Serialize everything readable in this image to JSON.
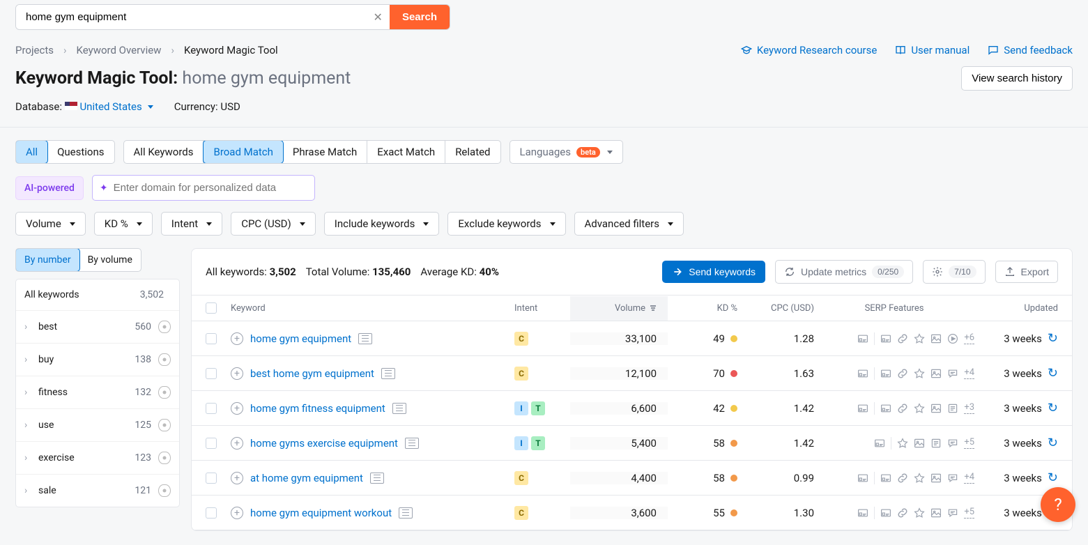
{
  "search": {
    "value": "home gym equipment",
    "button": "Search"
  },
  "breadcrumb": {
    "projects": "Projects",
    "overview": "Keyword Overview",
    "current": "Keyword Magic Tool"
  },
  "rlinks": {
    "course": "Keyword Research course",
    "manual": "User manual",
    "feedback": "Send feedback"
  },
  "title": {
    "main": "Keyword Magic Tool:",
    "sub": "home gym equipment"
  },
  "history_btn": "View search history",
  "meta": {
    "db_label": "Database:",
    "country": "United States",
    "cur_label": "Currency:",
    "cur": "USD"
  },
  "tabs1": {
    "all": "All",
    "questions": "Questions"
  },
  "tabs2": {
    "all_kw": "All Keywords",
    "broad": "Broad Match",
    "phrase": "Phrase Match",
    "exact": "Exact Match",
    "related": "Related"
  },
  "lang": {
    "label": "Languages",
    "badge": "beta"
  },
  "ai": {
    "tag": "AI-powered",
    "placeholder": "Enter domain for personalized data"
  },
  "filters": {
    "volume": "Volume",
    "kd": "KD %",
    "intent": "Intent",
    "cpc": "CPC (USD)",
    "include": "Include keywords",
    "exclude": "Exclude keywords",
    "advanced": "Advanced filters"
  },
  "side_tabs": {
    "number": "By number",
    "volume": "By volume"
  },
  "side_all": {
    "label": "All keywords",
    "count": "3,502"
  },
  "side_items": [
    {
      "label": "best",
      "count": "560"
    },
    {
      "label": "buy",
      "count": "138"
    },
    {
      "label": "fitness",
      "count": "132"
    },
    {
      "label": "use",
      "count": "125"
    },
    {
      "label": "exercise",
      "count": "123"
    },
    {
      "label": "sale",
      "count": "121"
    }
  ],
  "summary": {
    "all_kw_lbl": "All keywords:",
    "all_kw": "3,502",
    "tv_lbl": "Total Volume:",
    "tv": "135,460",
    "kd_lbl": "Average KD:",
    "kd": "40%"
  },
  "actions": {
    "send": "Send keywords",
    "update": "Update metrics",
    "update_pill": "0/250",
    "gear_pill": "7/10",
    "export": "Export"
  },
  "thead": {
    "kw": "Keyword",
    "intent": "Intent",
    "vol": "Volume",
    "kd": "KD %",
    "cpc": "CPC (USD)",
    "serp": "SERP Features",
    "upd": "Updated"
  },
  "rows": [
    {
      "kw": "home gym equipment",
      "intents": [
        "C"
      ],
      "vol": "33,100",
      "kd": "49",
      "kd_color": "#f2c94c",
      "cpc": "1.28",
      "serp_icons": [
        "ads",
        "link",
        "star",
        "image",
        "video"
      ],
      "more": "+6",
      "upd": "3 weeks"
    },
    {
      "kw": "best home gym equipment",
      "intents": [
        "C"
      ],
      "vol": "12,100",
      "kd": "70",
      "kd_color": "#eb5757",
      "cpc": "1.63",
      "serp_icons": [
        "ads",
        "link",
        "star",
        "image",
        "chat"
      ],
      "more": "+4",
      "upd": "3 weeks"
    },
    {
      "kw": "home gym fitness equipment",
      "intents": [
        "I",
        "T"
      ],
      "vol": "6,600",
      "kd": "42",
      "kd_color": "#f2c94c",
      "cpc": "1.42",
      "serp_icons": [
        "ads",
        "link",
        "star",
        "image",
        "doc"
      ],
      "more": "+3",
      "upd": "3 weeks"
    },
    {
      "kw": "home gyms exercise equipment",
      "intents": [
        "I",
        "T"
      ],
      "vol": "5,400",
      "kd": "58",
      "kd_color": "#f2994a",
      "cpc": "1.42",
      "serp_icons": [
        "star",
        "image",
        "doc",
        "chat"
      ],
      "more": "+5",
      "upd": "3 weeks"
    },
    {
      "kw": "at home gym equipment",
      "intents": [
        "C"
      ],
      "vol": "4,400",
      "kd": "58",
      "kd_color": "#f2994a",
      "cpc": "0.99",
      "serp_icons": [
        "ads",
        "link",
        "star",
        "image",
        "chat"
      ],
      "more": "+4",
      "upd": "3 weeks"
    },
    {
      "kw": "home gym equipment workout",
      "intents": [
        "C"
      ],
      "vol": "3,600",
      "kd": "55",
      "kd_color": "#f2994a",
      "cpc": "1.30",
      "serp_icons": [
        "ads",
        "link",
        "star",
        "image",
        "chat"
      ],
      "more": "+5",
      "upd": "3 weeks"
    }
  ]
}
